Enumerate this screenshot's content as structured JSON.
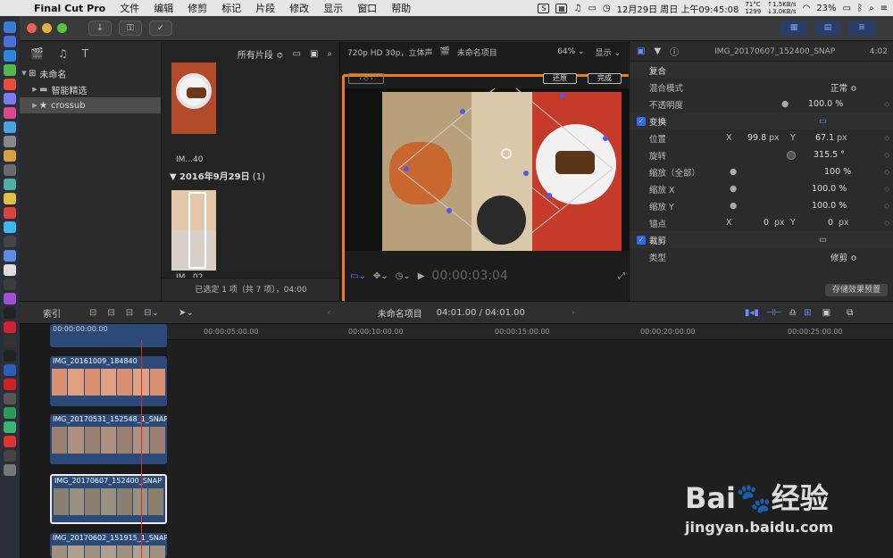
{
  "menubar": {
    "app_name": "Final Cut Pro",
    "menus": [
      "文件",
      "编辑",
      "修剪",
      "标记",
      "片段",
      "修改",
      "显示",
      "窗口",
      "帮助"
    ],
    "status": {
      "temp": "71°C",
      "fan": "1299",
      "net_up": "↑1.5KB/s",
      "net_down": "↓3.0KB/s",
      "battery": "23%",
      "clock": "12月29日 周日 上午09:45:08"
    }
  },
  "library": {
    "name": "未命名",
    "items": [
      {
        "label": "智能精选"
      },
      {
        "label": "crossub"
      }
    ]
  },
  "browser": {
    "filter": "所有片段 ≎",
    "date_group": "2016年9月29日",
    "date_count": "(1)",
    "clip1_label": "IM...40",
    "clip2_label": "IM...02",
    "status": "已选定 1 项（共 7 项），04:00"
  },
  "viewer": {
    "format": "720p HD 30p，立体声",
    "project": "未命名项目",
    "zoom": "64% ⌄",
    "display": "显示 ⌄",
    "reset": "还原",
    "done": "完成",
    "timecode": "00:00:03:04"
  },
  "inspector": {
    "clip_name": "IMG_20170607_152400_SNAP",
    "duration": "4:02",
    "sections": {
      "composite": "复合",
      "blend_mode_label": "混合模式",
      "blend_mode_value": "正常 ≎",
      "opacity_label": "不透明度",
      "opacity_value": "100.0 %",
      "transform": "变换",
      "position_label": "位置",
      "pos_x_label": "X",
      "pos_x": "99.8",
      "px1": "px",
      "pos_y_label": "Y",
      "pos_y": "67.1",
      "px2": "px",
      "rotation_label": "旋转",
      "rotation_value": "315.5 °",
      "scale_all_label": "缩放（全部）",
      "scale_all_value": "100 %",
      "scale_x_label": "缩放 X",
      "scale_x_value": "100.0 %",
      "scale_y_label": "缩放 Y",
      "scale_y_value": "100.0 %",
      "anchor_label": "锚点",
      "anchor_x_label": "X",
      "anchor_x": "0",
      "px3": "px",
      "anchor_y_label": "Y",
      "anchor_y": "0",
      "px4": "px",
      "crop": "裁剪",
      "type_label": "类型",
      "type_value": "修剪 ≎"
    },
    "save_preset": "存储效果预置"
  },
  "timeline_bar": {
    "index": "索引",
    "project": "未命名项目",
    "duration": "04:01.00 / 04:01.00"
  },
  "ruler": [
    "00:00:00:00.00",
    "00:00:05:00.00",
    "00:00:10:00.00",
    "00:00:15:00.00",
    "00:00:20:00.00",
    "00:00:25:00.00"
  ],
  "clips": [
    {
      "label": "IMG_20161009_184840"
    },
    {
      "label": "IMG_20170531_152548_1_SNAP"
    },
    {
      "label": "IMG_20170607_152400_SNAP"
    },
    {
      "label": "IMG_20170602_151915_1_SNAP"
    }
  ],
  "watermark": {
    "brand": "Bai",
    "brand2": "经验",
    "url": "jingyan.baidu.com"
  }
}
